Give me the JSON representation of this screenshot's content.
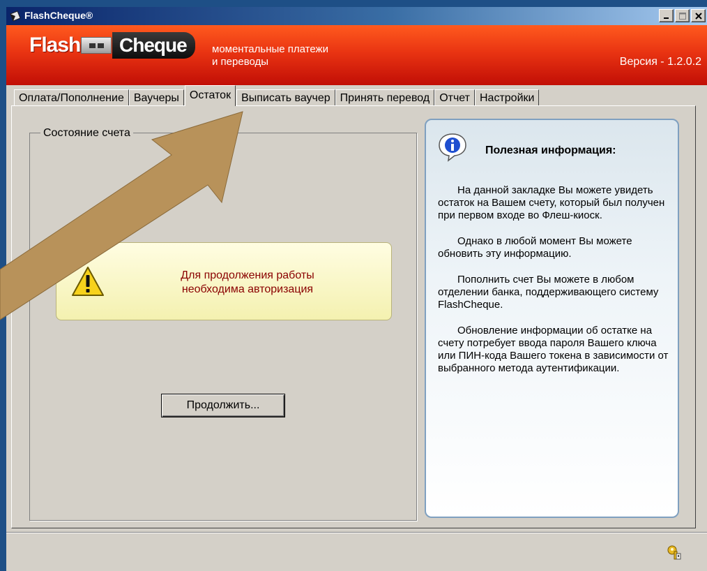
{
  "window": {
    "title": "FlashCheque®",
    "controls": [
      "minimize",
      "maximize",
      "close"
    ]
  },
  "banner": {
    "logo_part1": "Flash",
    "logo_part2": "Cheque",
    "tagline_line1": "моментальные платежи",
    "tagline_line2": "и переводы",
    "version": "Версия - 1.2.0.2",
    "colors": {
      "banner_top": "#ff5a1e",
      "banner_bottom": "#c10e06"
    }
  },
  "tabs": [
    {
      "label": "Оплата/Пополнение",
      "active": false
    },
    {
      "label": "Ваучеры",
      "active": false
    },
    {
      "label": "Остаток",
      "active": true
    },
    {
      "label": "Выписать ваучер",
      "active": false
    },
    {
      "label": "Принять перевод",
      "active": false
    },
    {
      "label": "Отчет",
      "active": false
    },
    {
      "label": "Настройки",
      "active": false
    }
  ],
  "account": {
    "group_label": "Состояние счета",
    "warning_icon": "warning-icon",
    "warning_line1": "Для продолжения работы",
    "warning_line2": "необходима авторизация",
    "continue_label": "Продолжить..."
  },
  "info": {
    "icon": "info-icon",
    "title": "Полезная информация:",
    "paragraphs": [
      "На данной закладке Вы можете увидеть остаток на Вашем счету, который был получен при первом входе во Флеш-киоск.",
      "Однако в любой момент Вы можете обновить эту информацию.",
      "Пополнить счет Вы можете в любом отделении банка, поддерживающего систему FlashCheque.",
      "Обновление информации об остатке на счету потребует ввода пароля Вашего ключа или ПИН-кода Вашего токена в зависимости от выбранного метода аутентификации."
    ]
  },
  "statusbar": {
    "icon": "key-icon"
  },
  "annotation": {
    "icon": "arrow-icon",
    "color": "#b8925a"
  }
}
